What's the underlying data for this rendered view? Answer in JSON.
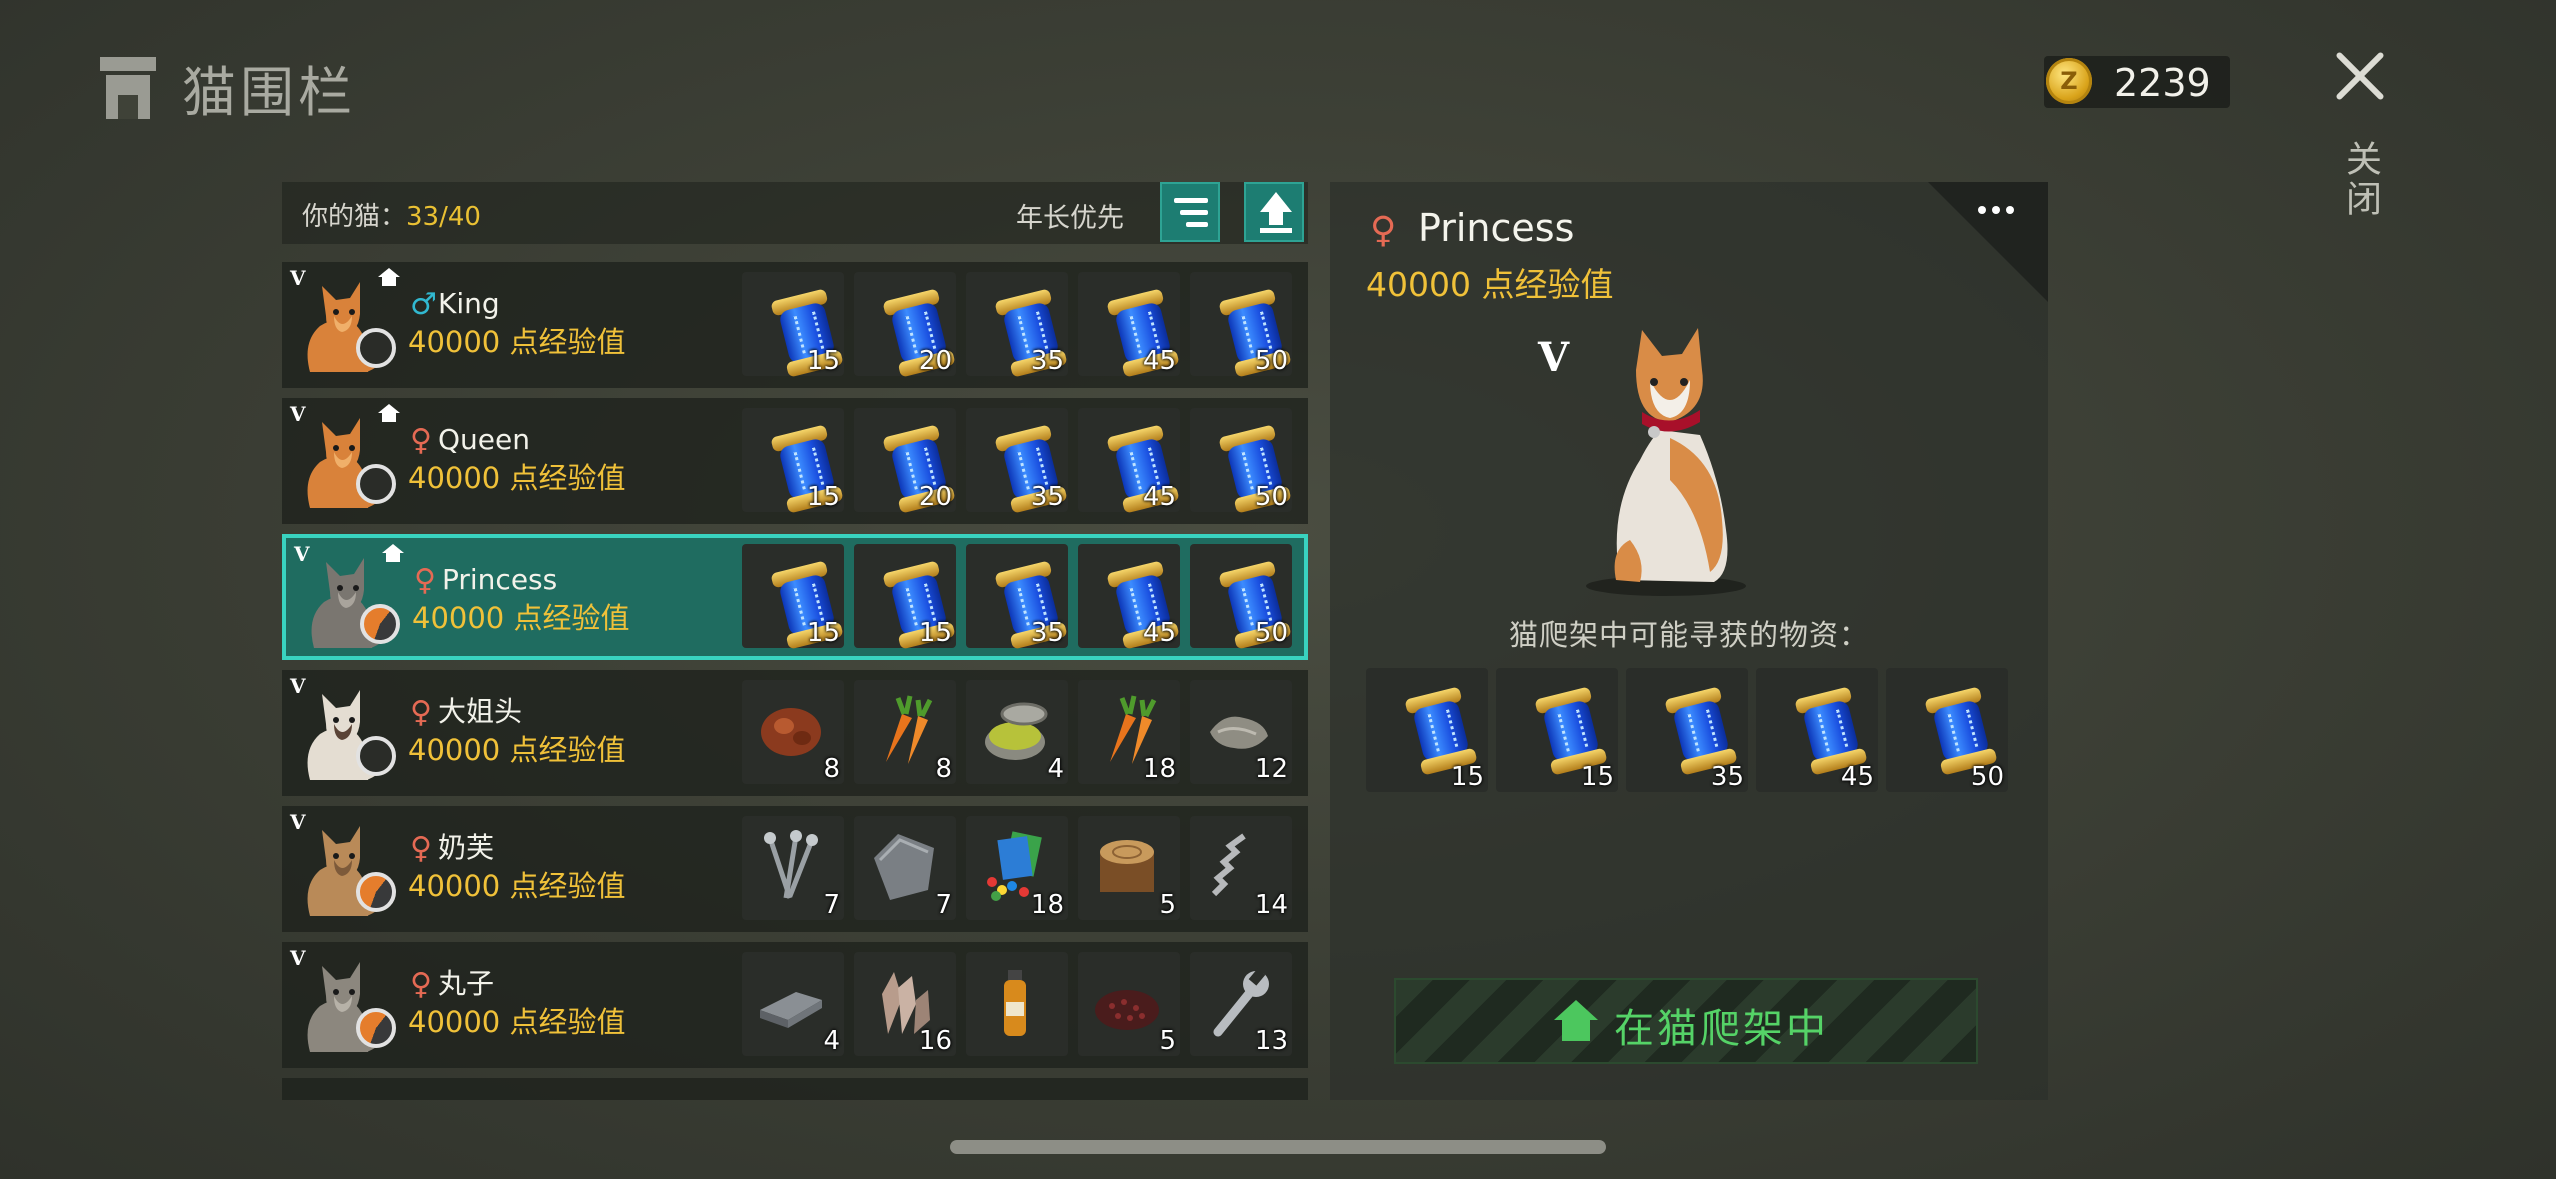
{
  "header": {
    "title": "猫围栏",
    "coins": "2239",
    "close_label": "关闭"
  },
  "list": {
    "your_cats_label": "你的猫：",
    "your_cats_count": "33/40",
    "sort_label": "年长优先",
    "rows": [
      {
        "rank": "V",
        "gender_symbol": "♂",
        "name": "King",
        "exp": "40000 点经验值",
        "items": [
          {
            "icon": "dna-capsule",
            "qty": "15"
          },
          {
            "icon": "dna-capsule",
            "qty": "20"
          },
          {
            "icon": "dna-capsule",
            "qty": "35"
          },
          {
            "icon": "dna-capsule",
            "qty": "45"
          },
          {
            "icon": "dna-capsule",
            "qty": "50"
          }
        ]
      },
      {
        "rank": "V",
        "gender_symbol": "♀",
        "name": "Queen",
        "exp": "40000 点经验值",
        "items": [
          {
            "icon": "dna-capsule",
            "qty": "15"
          },
          {
            "icon": "dna-capsule",
            "qty": "20"
          },
          {
            "icon": "dna-capsule",
            "qty": "35"
          },
          {
            "icon": "dna-capsule",
            "qty": "45"
          },
          {
            "icon": "dna-capsule",
            "qty": "50"
          }
        ]
      },
      {
        "rank": "V",
        "gender_symbol": "♀",
        "name": "Princess",
        "exp": "40000 点经验值",
        "items": [
          {
            "icon": "dna-capsule",
            "qty": "15"
          },
          {
            "icon": "dna-capsule",
            "qty": "15"
          },
          {
            "icon": "dna-capsule",
            "qty": "35"
          },
          {
            "icon": "dna-capsule",
            "qty": "45"
          },
          {
            "icon": "dna-capsule",
            "qty": "50"
          }
        ]
      },
      {
        "rank": "V",
        "gender_symbol": "♀",
        "name": "大姐头",
        "exp": "40000 点经验值",
        "items": [
          {
            "icon": "raw-meat",
            "qty": "8"
          },
          {
            "icon": "carrot",
            "qty": "8"
          },
          {
            "icon": "tin-can",
            "qty": "4"
          },
          {
            "icon": "carrot",
            "qty": "18"
          },
          {
            "icon": "cloth",
            "qty": "12"
          }
        ]
      },
      {
        "rank": "V",
        "gender_symbol": "♀",
        "name": "奶芙",
        "exp": "40000 点经验值",
        "items": [
          {
            "icon": "nails",
            "qty": "7"
          },
          {
            "icon": "metal-plate",
            "qty": "7"
          },
          {
            "icon": "cards",
            "qty": "18"
          },
          {
            "icon": "log",
            "qty": "5"
          },
          {
            "icon": "spring",
            "qty": "14"
          }
        ]
      },
      {
        "rank": "V",
        "gender_symbol": "♀",
        "name": "丸子",
        "exp": "40000 点经验值",
        "items": [
          {
            "icon": "iron-ingot",
            "qty": "4"
          },
          {
            "icon": "crystal",
            "qty": "16"
          },
          {
            "icon": "bottle",
            "qty": ""
          },
          {
            "icon": "seeds",
            "qty": "5"
          },
          {
            "icon": "wrench",
            "qty": "13"
          }
        ]
      }
    ]
  },
  "detail": {
    "gender_symbol": "♀",
    "name": "Princess",
    "exp": "40000 点经验值",
    "rank": "V",
    "loot_title": "猫爬架中可能寻获的物资：",
    "loot": [
      {
        "icon": "dna-capsule",
        "qty": "15"
      },
      {
        "icon": "dna-capsule",
        "qty": "15"
      },
      {
        "icon": "dna-capsule",
        "qty": "35"
      },
      {
        "icon": "dna-capsule",
        "qty": "45"
      },
      {
        "icon": "dna-capsule",
        "qty": "50"
      }
    ],
    "status": "在猫爬架中"
  },
  "colors": {
    "accent_teal": "#1d7d72",
    "selected_border": "#39d3c0",
    "exp_gold": "#f0c139",
    "status_green": "#55d367"
  }
}
